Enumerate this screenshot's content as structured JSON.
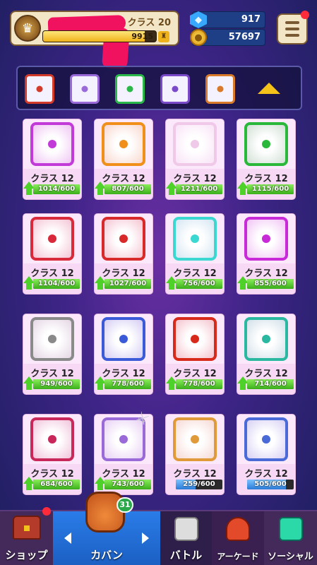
{
  "header": {
    "class_label": "クラス 20",
    "xp_value": "9915",
    "xp_fraction": 0.9,
    "gems": "917",
    "gold": "57697"
  },
  "deck": {
    "dice": [
      {
        "color": "#d23a2a"
      },
      {
        "color": "#9a6ad8"
      },
      {
        "color": "#2ab84a"
      },
      {
        "color": "#7a4ac8"
      },
      {
        "color": "#d87a2a"
      }
    ],
    "expand_icon": "triangle-up-icon"
  },
  "cards": [
    {
      "label": "クラス 12",
      "progress": "1014/600",
      "fraction": 1.0,
      "color": "#c23ad8",
      "upgradable": true
    },
    {
      "label": "クラス 12",
      "progress": "807/600",
      "fraction": 1.0,
      "color": "#f0901a",
      "upgradable": true
    },
    {
      "label": "クラス 12",
      "progress": "1211/600",
      "fraction": 1.0,
      "color": "#f0c8e8",
      "upgradable": true
    },
    {
      "label": "クラス 12",
      "progress": "1115/600",
      "fraction": 1.0,
      "color": "#2ab83a",
      "upgradable": true
    },
    {
      "label": "クラス 12",
      "progress": "1104/600",
      "fraction": 1.0,
      "color": "#d82a3a",
      "upgradable": true
    },
    {
      "label": "クラス 12",
      "progress": "1027/600",
      "fraction": 1.0,
      "color": "#d82a2a",
      "upgradable": true
    },
    {
      "label": "クラス 12",
      "progress": "756/600",
      "fraction": 1.0,
      "color": "#3ad8d0",
      "upgradable": true
    },
    {
      "label": "クラス 12",
      "progress": "855/600",
      "fraction": 1.0,
      "color": "#c82ad8",
      "upgradable": true
    },
    {
      "label": "クラス 12",
      "progress": "949/600",
      "fraction": 1.0,
      "color": "#8a8a8a",
      "upgradable": true
    },
    {
      "label": "クラス 12",
      "progress": "778/600",
      "fraction": 1.0,
      "color": "#3a5ad8",
      "upgradable": true
    },
    {
      "label": "クラス 12",
      "progress": "778/600",
      "fraction": 1.0,
      "color": "#d82a1a",
      "upgradable": true
    },
    {
      "label": "クラス 12",
      "progress": "714/600",
      "fraction": 1.0,
      "color": "#2ab8a0",
      "upgradable": true
    },
    {
      "label": "クラス 12",
      "progress": "684/600",
      "fraction": 1.0,
      "color": "#c8285a",
      "upgradable": true
    },
    {
      "label": "クラス 12",
      "progress": "743/600",
      "fraction": 1.0,
      "color": "#9a6ad8",
      "upgradable": true
    },
    {
      "label": "クラス 12",
      "progress": "259/600",
      "fraction": 0.43,
      "color": "#e09a3a",
      "upgradable": false
    },
    {
      "label": "クラス 12",
      "progress": "505/600",
      "fraction": 0.84,
      "color": "#4a6ad8",
      "upgradable": false
    }
  ],
  "nav": {
    "shop": "ショップ",
    "bag": "カバン",
    "bag_badge": "31",
    "battle": "バトル",
    "arcade": "アーケード",
    "social": "ソーシャル"
  }
}
